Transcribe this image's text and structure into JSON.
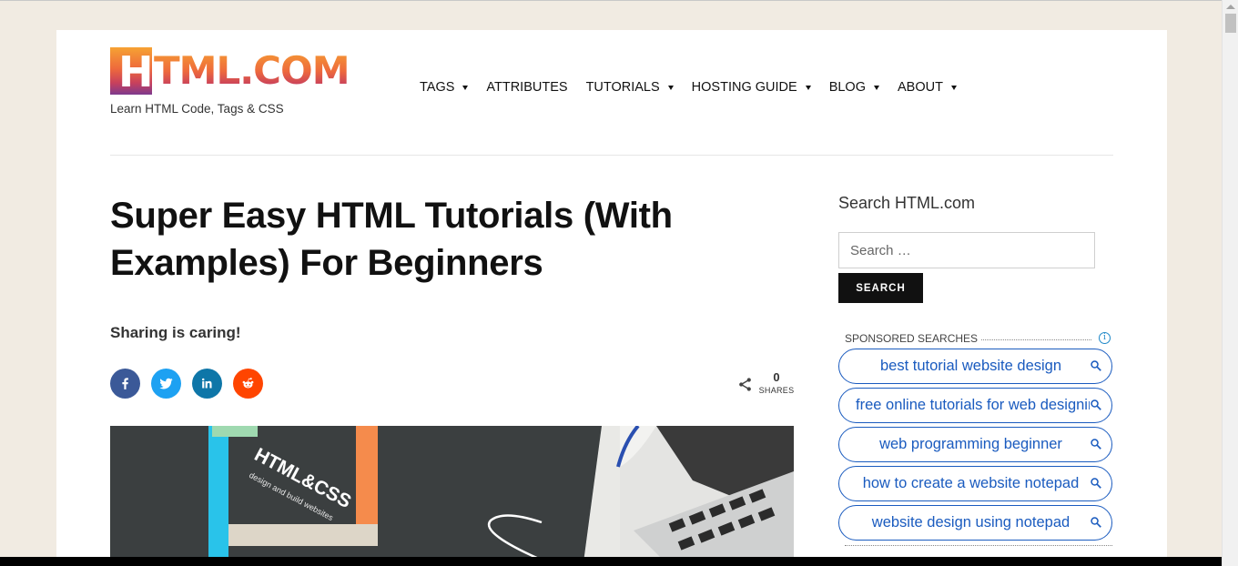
{
  "site": {
    "logo_letter": "H",
    "logo_text": "TML.COM",
    "tagline": "Learn HTML Code, Tags & CSS"
  },
  "nav": [
    {
      "label": "TAGS",
      "has_dropdown": true
    },
    {
      "label": "ATTRIBUTES",
      "has_dropdown": false
    },
    {
      "label": "TUTORIALS",
      "has_dropdown": true
    },
    {
      "label": "HOSTING GUIDE",
      "has_dropdown": true
    },
    {
      "label": "BLOG",
      "has_dropdown": true
    },
    {
      "label": "ABOUT",
      "has_dropdown": true
    }
  ],
  "article": {
    "title": "Super Easy HTML Tutorials (With Examples) For Beginners",
    "share_label": "Sharing is caring!",
    "share_count": "0",
    "share_count_label": "SHARES",
    "social": [
      {
        "name": "facebook",
        "icon": "facebook-icon",
        "color": "#3b5998"
      },
      {
        "name": "twitter",
        "icon": "twitter-icon",
        "color": "#1da1f2"
      },
      {
        "name": "linkedin",
        "icon": "linkedin-icon",
        "color": "#0e76a8"
      },
      {
        "name": "reddit",
        "icon": "reddit-icon",
        "color": "#ff4500"
      }
    ],
    "hero_book_title": "HTML&CSS",
    "hero_book_subtitle": "design and build websites"
  },
  "sidebar": {
    "search_title": "Search HTML.com",
    "search_placeholder": "Search …",
    "search_button": "SEARCH",
    "sponsored_label": "SPONSORED SEARCHES",
    "sponsored_items": [
      "best tutorial website design",
      "free online tutorials for web designing",
      "web programming beginner",
      "how to create a website notepad",
      "website design using notepad"
    ]
  },
  "colors": {
    "page_bg": "#f1ebe2",
    "accent_link": "#1a5bbf",
    "button_bg": "#111111"
  }
}
